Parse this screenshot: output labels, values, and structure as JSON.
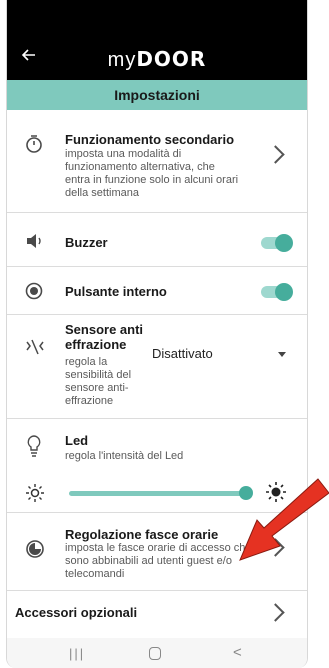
{
  "header": {
    "back_icon": "arrow-left-icon",
    "logo_my": "my",
    "logo_door": "DOOR"
  },
  "title": "Impostazioni",
  "items": {
    "secondary": {
      "title": "Funzionamento secondario",
      "desc": "imposta una modalità di funzionamento alternativa, che entra in funzione solo in alcuni orari della settimana",
      "icon": "timer-icon"
    },
    "buzzer": {
      "title": "Buzzer",
      "icon": "speaker-icon",
      "enabled": true
    },
    "internal_button": {
      "title": "Pulsante interno",
      "icon": "radio-button-icon",
      "enabled": true
    },
    "tamper": {
      "title": "Sensore anti effrazione",
      "desc": "regola la sensibilità del sensore anti-effrazione",
      "value": "Disattivato",
      "icon": "vibration-icon"
    },
    "led": {
      "title": "Led",
      "desc": "regola l'intensità del Led",
      "icon": "lightbulb-icon",
      "intensity": 0.95
    },
    "time_slots": {
      "title": "Regolazione fasce orarie",
      "desc": "imposta le fasce orarie di accesso che sono abbinabili ad utenti guest e/o telecomandi",
      "icon": "clock-icon"
    },
    "accessories": {
      "title": "Accessori opzionali"
    }
  },
  "navbar": {
    "recent": "|||",
    "home": "home-icon",
    "back": "<"
  },
  "colors": {
    "accent": "#46ad9c",
    "title_bar": "#7fc9bd",
    "arrow": "#e53222"
  }
}
